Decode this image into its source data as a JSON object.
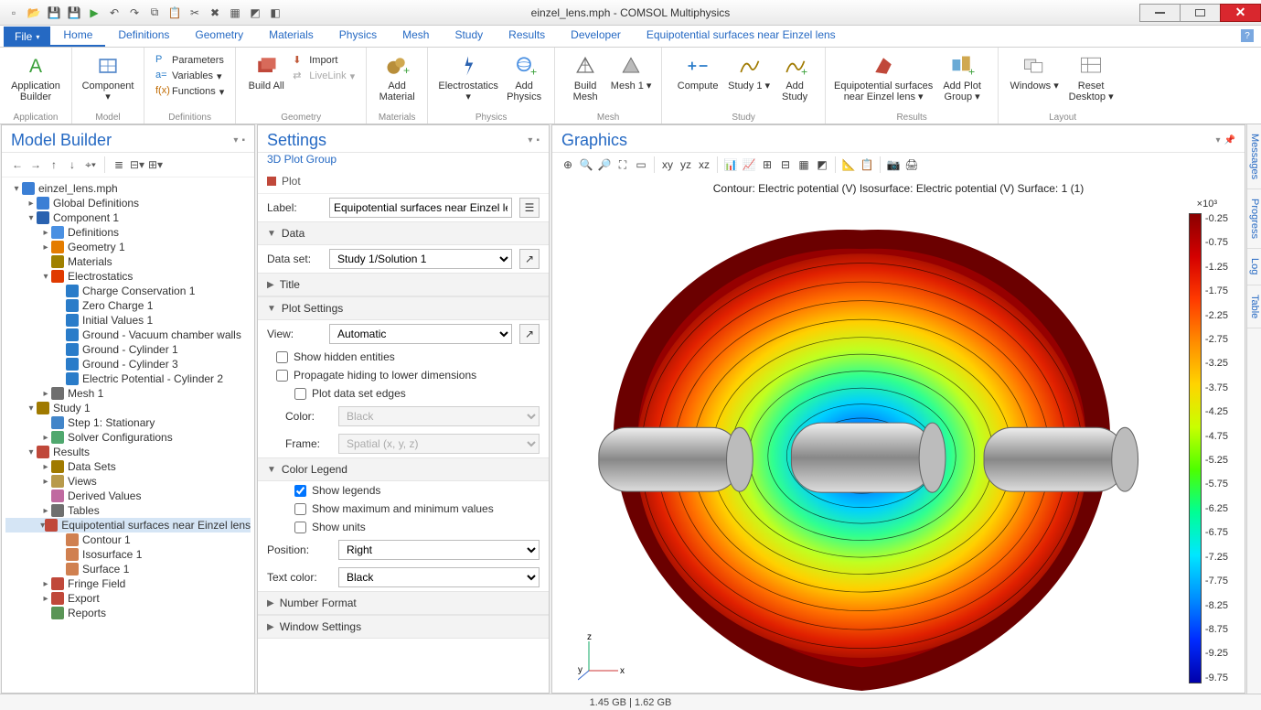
{
  "window": {
    "title": "einzel_lens.mph - COMSOL Multiphysics"
  },
  "ribbon_tabs": {
    "file": "File",
    "items": [
      "Home",
      "Definitions",
      "Geometry",
      "Materials",
      "Physics",
      "Mesh",
      "Study",
      "Results",
      "Developer",
      "Equipotential surfaces near Einzel lens"
    ],
    "active": 0
  },
  "ribbon": {
    "application": {
      "app_builder": "Application\nBuilder",
      "label": "Application"
    },
    "model": {
      "component": "Component",
      "label": "Model"
    },
    "definitions": {
      "parameters": "Parameters",
      "variables": "Variables",
      "functions": "Functions",
      "label": "Definitions"
    },
    "geometry": {
      "build_all": "Build\nAll",
      "import": "Import",
      "livelink": "LiveLink",
      "label": "Geometry"
    },
    "materials": {
      "add_material": "Add\nMaterial",
      "label": "Materials"
    },
    "physics": {
      "electrostatics": "Electrostatics",
      "add_physics": "Add\nPhysics",
      "label": "Physics"
    },
    "mesh": {
      "build_mesh": "Build\nMesh",
      "mesh1": "Mesh\n1",
      "label": "Mesh"
    },
    "study": {
      "compute": "Compute",
      "study1": "Study\n1",
      "add_study": "Add\nStudy",
      "label": "Study"
    },
    "results": {
      "equipot": "Equipotential surfaces\nnear Einzel lens",
      "add_plot_group": "Add Plot\nGroup",
      "label": "Results"
    },
    "layout": {
      "windows": "Windows",
      "reset": "Reset\nDesktop",
      "label": "Layout"
    }
  },
  "model_builder": {
    "title": "Model Builder",
    "tree": [
      {
        "d": 0,
        "tw": "▾",
        "ic": "#3b7fd5",
        "txt": "einzel_lens.mph"
      },
      {
        "d": 1,
        "tw": "▸",
        "ic": "#3b7fd5",
        "txt": "Global Definitions"
      },
      {
        "d": 1,
        "tw": "▾",
        "ic": "#2a62b0",
        "txt": "Component 1"
      },
      {
        "d": 2,
        "tw": "▸",
        "ic": "#4a90e2",
        "txt": "Definitions"
      },
      {
        "d": 2,
        "tw": "▸",
        "ic": "#e47c00",
        "txt": "Geometry 1"
      },
      {
        "d": 2,
        "tw": "",
        "ic": "#9f8000",
        "txt": "Materials"
      },
      {
        "d": 2,
        "tw": "▾",
        "ic": "#e03a00",
        "txt": "Electrostatics"
      },
      {
        "d": 3,
        "tw": "",
        "ic": "#2a7cc9",
        "txt": "Charge Conservation 1"
      },
      {
        "d": 3,
        "tw": "",
        "ic": "#2a7cc9",
        "txt": "Zero Charge 1"
      },
      {
        "d": 3,
        "tw": "",
        "ic": "#2a7cc9",
        "txt": "Initial Values 1"
      },
      {
        "d": 3,
        "tw": "",
        "ic": "#2a7cc9",
        "txt": "Ground - Vacuum chamber walls"
      },
      {
        "d": 3,
        "tw": "",
        "ic": "#2a7cc9",
        "txt": "Ground - Cylinder 1"
      },
      {
        "d": 3,
        "tw": "",
        "ic": "#2a7cc9",
        "txt": "Ground - Cylinder 3"
      },
      {
        "d": 3,
        "tw": "",
        "ic": "#2a7cc9",
        "txt": "Electric Potential - Cylinder 2"
      },
      {
        "d": 2,
        "tw": "▸",
        "ic": "#6f6f6f",
        "txt": "Mesh 1"
      },
      {
        "d": 1,
        "tw": "▾",
        "ic": "#a07a00",
        "txt": "Study 1"
      },
      {
        "d": 2,
        "tw": "",
        "ic": "#4285c9",
        "txt": "Step 1: Stationary"
      },
      {
        "d": 2,
        "tw": "▸",
        "ic": "#4fa86e",
        "txt": "Solver Configurations"
      },
      {
        "d": 1,
        "tw": "▾",
        "ic": "#c0483a",
        "txt": "Results"
      },
      {
        "d": 2,
        "tw": "▸",
        "ic": "#a07a00",
        "txt": "Data Sets"
      },
      {
        "d": 2,
        "tw": "▸",
        "ic": "#b89a4b",
        "txt": "Views"
      },
      {
        "d": 2,
        "tw": "",
        "ic": "#c06aa0",
        "txt": "Derived Values"
      },
      {
        "d": 2,
        "tw": "▸",
        "ic": "#6f6f6f",
        "txt": "Tables"
      },
      {
        "d": 2,
        "tw": "▾",
        "ic": "#c0483a",
        "txt": "Equipotential surfaces near Einzel lens",
        "sel": true
      },
      {
        "d": 3,
        "tw": "",
        "ic": "#d08050",
        "txt": "Contour 1"
      },
      {
        "d": 3,
        "tw": "",
        "ic": "#d08050",
        "txt": "Isosurface 1"
      },
      {
        "d": 3,
        "tw": "",
        "ic": "#d08050",
        "txt": "Surface 1"
      },
      {
        "d": 2,
        "tw": "▸",
        "ic": "#c0483a",
        "txt": "Fringe Field"
      },
      {
        "d": 2,
        "tw": "▸",
        "ic": "#c0483a",
        "txt": "Export"
      },
      {
        "d": 2,
        "tw": "",
        "ic": "#5a9556",
        "txt": "Reports"
      }
    ]
  },
  "settings": {
    "title": "Settings",
    "subtitle": "3D Plot Group",
    "plot_btn": "Plot",
    "label_caption": "Label:",
    "label_value": "Equipotential surfaces near Einzel lens",
    "sections": {
      "data": "Data",
      "title": "Title",
      "plot_settings": "Plot Settings",
      "color_legend": "Color Legend",
      "number_format": "Number Format",
      "window_settings": "Window Settings"
    },
    "data_set_caption": "Data set:",
    "data_set_value": "Study 1/Solution 1",
    "view_caption": "View:",
    "view_value": "Automatic",
    "show_hidden": "Show hidden entities",
    "propagate": "Propagate hiding to lower dimensions",
    "plot_edges": "Plot data set edges",
    "color_caption": "Color:",
    "color_value": "Black",
    "frame_caption": "Frame:",
    "frame_value": "Spatial  (x, y, z)",
    "show_legends": "Show legends",
    "show_minmax": "Show maximum and minimum values",
    "show_units": "Show units",
    "position_caption": "Position:",
    "position_value": "Right",
    "textcolor_caption": "Text color:",
    "textcolor_value": "Black"
  },
  "graphics": {
    "title": "Graphics",
    "plot_title": "Contour: Electric potential (V)   Isosurface: Electric potential (V)   Surface: 1 (1)",
    "legend_expo": "×10³",
    "legend_ticks": [
      "-0.25",
      "-0.75",
      "-1.25",
      "-1.75",
      "-2.25",
      "-2.75",
      "-3.25",
      "-3.75",
      "-4.25",
      "-4.75",
      "-5.25",
      "-5.75",
      "-6.25",
      "-6.75",
      "-7.25",
      "-7.75",
      "-8.25",
      "-8.75",
      "-9.25",
      "-9.75"
    ],
    "axes": {
      "x": "x",
      "y": "y",
      "z": "z"
    }
  },
  "side_tabs": [
    "Messages",
    "Progress",
    "Log",
    "Table"
  ],
  "status": {
    "memory": "1.45 GB | 1.62 GB"
  }
}
